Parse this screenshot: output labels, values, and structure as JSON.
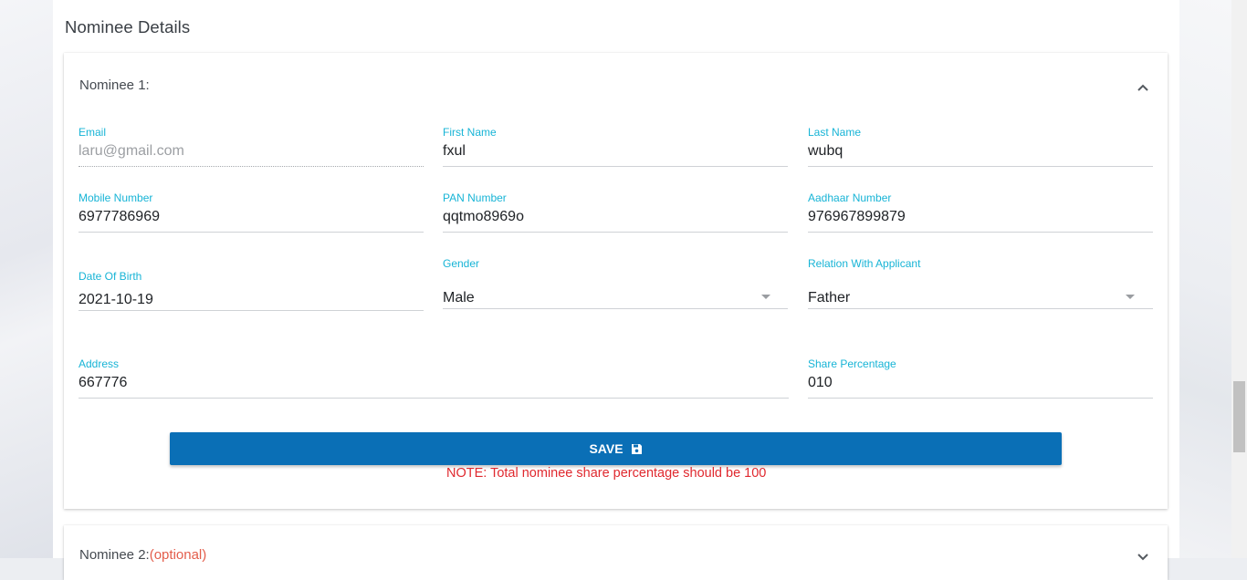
{
  "section": {
    "title": "Nominee Details"
  },
  "nominee1": {
    "header": "Nominee 1:",
    "fields": {
      "email": {
        "label": "Email",
        "value": "laru@gmail.com"
      },
      "first_name": {
        "label": "First Name",
        "value": "fxul"
      },
      "last_name": {
        "label": "Last Name",
        "value": "wubq"
      },
      "mobile": {
        "label": "Mobile Number",
        "value": "6977786969"
      },
      "pan": {
        "label": "PAN Number",
        "value": "qqtmo8969o"
      },
      "aadhaar": {
        "label": "Aadhaar Number",
        "value": "976967899879"
      },
      "dob": {
        "label": "Date Of Birth",
        "value": "2021-10-19"
      },
      "gender": {
        "label": "Gender",
        "value": "Male"
      },
      "relation": {
        "label": "Relation With Applicant",
        "value": "Father"
      },
      "address": {
        "label": "Address",
        "value": "667776"
      },
      "share": {
        "label": "Share Percentage",
        "value": "010"
      }
    },
    "save_label": "SAVE",
    "note": "NOTE: Total nominee share percentage should be 100"
  },
  "nominee2": {
    "header": "Nominee 2:",
    "optional_label": "(optional)"
  },
  "icons": {
    "collapse": "chevron-up-icon",
    "save": "floppy-disk-icon",
    "dropdown": "caret-down-icon"
  },
  "colors": {
    "accent_label": "#17b4d6",
    "primary_button": "#0a6fb6",
    "note_text": "#e0292f",
    "optional_text": "#e35d4b"
  }
}
